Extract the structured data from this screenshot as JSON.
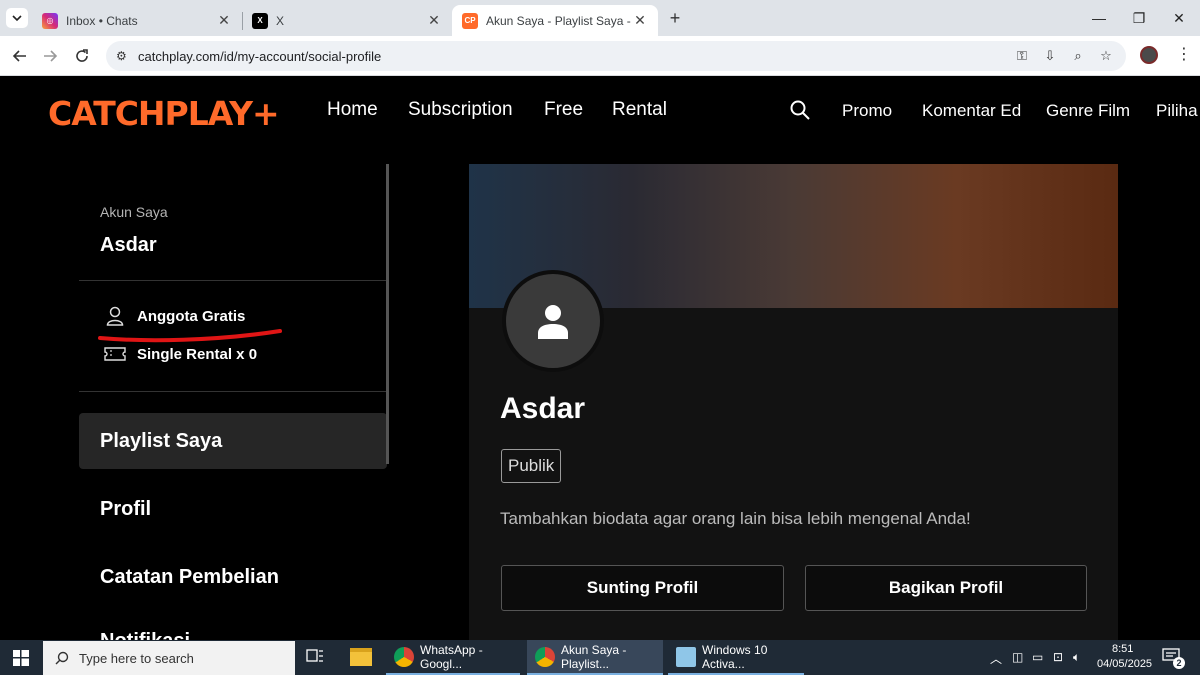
{
  "browser": {
    "tabs": [
      {
        "title": "Inbox • Chats",
        "icon": "instagram-icon"
      },
      {
        "title": "X",
        "icon": "x-logo-icon"
      },
      {
        "title": "Akun Saya - Playlist Saya - CATC",
        "icon": "catchplay-icon",
        "active": true
      }
    ],
    "url": "catchplay.com/id/my-account/social-profile"
  },
  "site": {
    "logo": "CATCHPLAY+",
    "nav": [
      "Home",
      "Subscription",
      "Free",
      "Rental"
    ],
    "nav_right": [
      "Promo",
      "Komentar Ed",
      "Genre Film",
      "Piliha"
    ]
  },
  "sidebar": {
    "account_label": "Akun Saya",
    "account_name": "Asdar",
    "membership": "Anggota Gratis",
    "rental": "Single Rental x 0",
    "items": [
      "Playlist Saya",
      "Profil",
      "Catatan Pembelian",
      "Notifikasi"
    ],
    "active_index": 0
  },
  "profile": {
    "name": "Asdar",
    "visibility": "Publik",
    "bio_placeholder": "Tambahkan biodata agar orang lain bisa lebih mengenal Anda!",
    "edit_button": "Sunting Profil",
    "share_button": "Bagikan Profil"
  },
  "annotation": {
    "color": "#e01515"
  },
  "taskbar": {
    "search_placeholder": "Type here to search",
    "apps": [
      "WhatsApp - Googl...",
      "Akun Saya - Playlist...",
      "Windows 10 Activa..."
    ],
    "time": "8:51",
    "date": "04/05/2025",
    "notifications": "2"
  },
  "colors": {
    "brand": "#ff6a2a",
    "page_bg": "#000000"
  }
}
